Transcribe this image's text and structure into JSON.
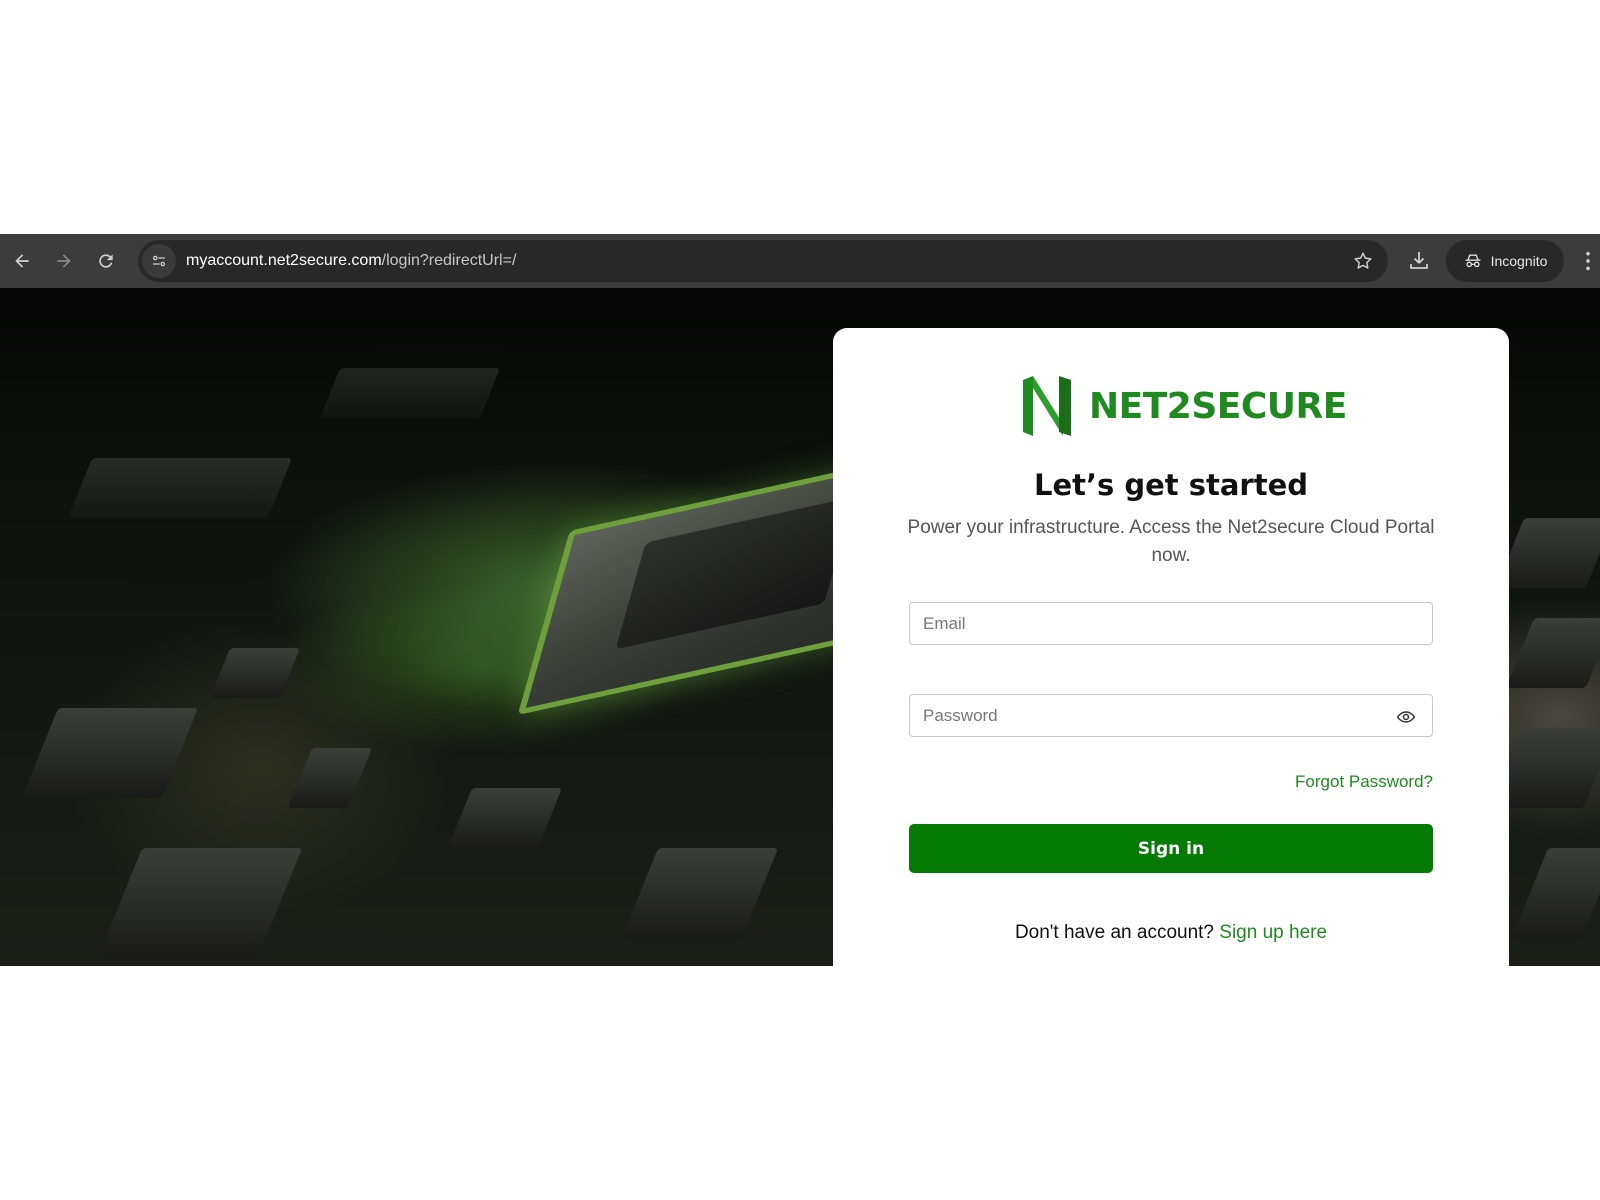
{
  "browser": {
    "url_host": "myaccount.net2secure.com",
    "url_path": "/login?redirectUrl=/",
    "incognito_label": "Incognito",
    "icons": [
      "back-arrow-icon",
      "forward-arrow-icon",
      "reload-icon",
      "site-info-icon",
      "star-icon",
      "download-icon",
      "incognito-icon",
      "more-vert-icon"
    ]
  },
  "login": {
    "brand": "NET2SECURE",
    "heading": "Let’s get started",
    "subtitle": "Power your infrastructure. Access the Net2secure Cloud Portal now.",
    "email_placeholder": "Email",
    "password_placeholder": "Password",
    "forgot_password": "Forgot Password?",
    "sign_in": "Sign in",
    "no_account": "Don't have an account?",
    "sign_up": "Sign up here"
  },
  "colors": {
    "brand_green": "#1f8a1f",
    "button_green": "#057a05",
    "chrome_bar": "#3c3c3c"
  }
}
